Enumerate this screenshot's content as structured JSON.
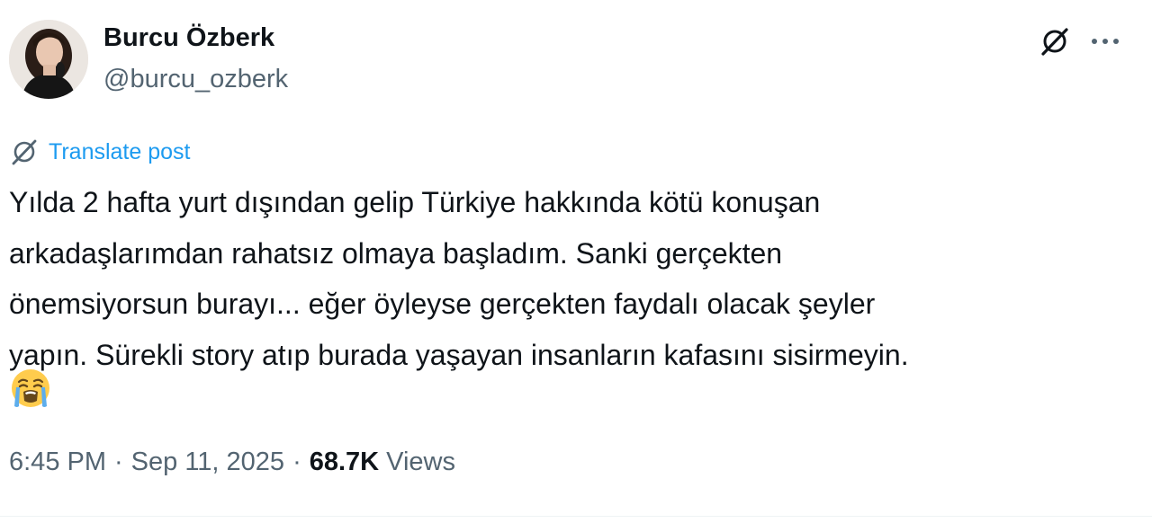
{
  "author": {
    "name": "Burcu Özberk",
    "handle": "@burcu_ozberk",
    "avatar_icon": "profile-photo"
  },
  "header_actions": {
    "grok_icon": "grok-icon",
    "more_icon": "more-icon",
    "more_glyph": "···"
  },
  "translate": {
    "label": "Translate post",
    "icon": "grok-icon",
    "color": "#1d9bf0"
  },
  "post": {
    "lines": [
      "Yılda 2 hafta yurt dışından gelip Türkiye hakkında kötü konuşan",
      "arkadaşlarımdan rahatsız olmaya başladım. Sanki gerçekten",
      "önemsiyorsun burayı... eğer öyleyse gerçekten faydalı olacak şeyler",
      "yapın. Sürekli story atıp burada yaşayan insanların kafasını sisirmeyin."
    ],
    "emoji": "loudly-crying-face"
  },
  "meta": {
    "time": "6:45 PM",
    "separator": "·",
    "date": "Sep 11, 2025",
    "views_count": "68.7K",
    "views_label": "Views"
  },
  "colors": {
    "primary_text": "#0f1419",
    "secondary_text": "#536471",
    "accent": "#1d9bf0",
    "divider": "#eff3f4"
  }
}
